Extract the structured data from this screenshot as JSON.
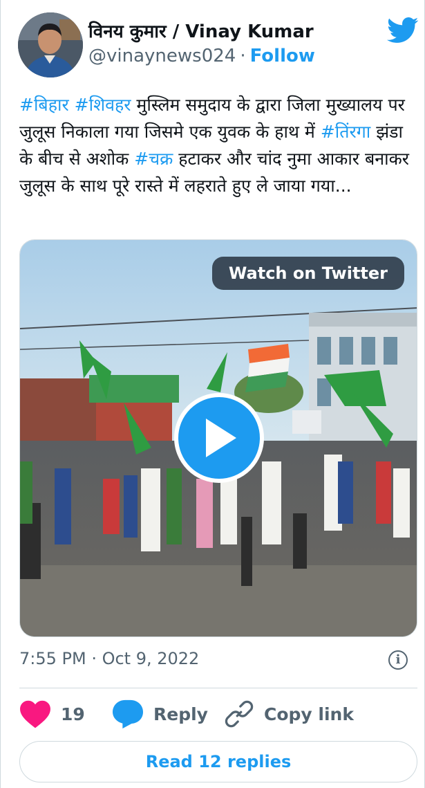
{
  "author": {
    "name": "विनय कुमार / Vinay Kumar",
    "handle": "@vinaynews024",
    "separator": "·",
    "follow_label": "Follow",
    "avatar_icon": "user-avatar-photo",
    "brand_icon": "twitter-bird-icon",
    "brand_color": "#1d9bf0"
  },
  "tweet": {
    "parts": [
      {
        "text": "#बिहार",
        "tag": true
      },
      {
        "text": " ",
        "tag": false
      },
      {
        "text": "#शिवहर",
        "tag": true
      },
      {
        "text": " मुस्लिम समुदाय के द्वारा जिला मुख्यालय पर जुलूस निकाला गया जिसमे एक युवक के हाथ में ",
        "tag": false
      },
      {
        "text": "#तिंरगा",
        "tag": true
      },
      {
        "text": " झंडा के बीच से अशोक ",
        "tag": false
      },
      {
        "text": "#चक्र",
        "tag": true
      },
      {
        "text": " हटाकर और चांद नुमा आकार बनाकर जुलूस के साथ पूरे रास्ते में लहराते हुए ले जाया गया...",
        "tag": false
      }
    ]
  },
  "media": {
    "watch_label": "Watch on Twitter",
    "play_icon": "play-icon",
    "play_color": "#1d9bf0"
  },
  "meta": {
    "timestamp": "7:55 PM · Oct 9, 2022",
    "info_icon": "info-icon"
  },
  "actions": {
    "like_count": "19",
    "like_color": "#f91880",
    "reply_label": "Reply",
    "reply_color": "#1d9bf0",
    "copy_label": "Copy link"
  },
  "footer": {
    "read_replies_label": "Read 12 replies"
  }
}
